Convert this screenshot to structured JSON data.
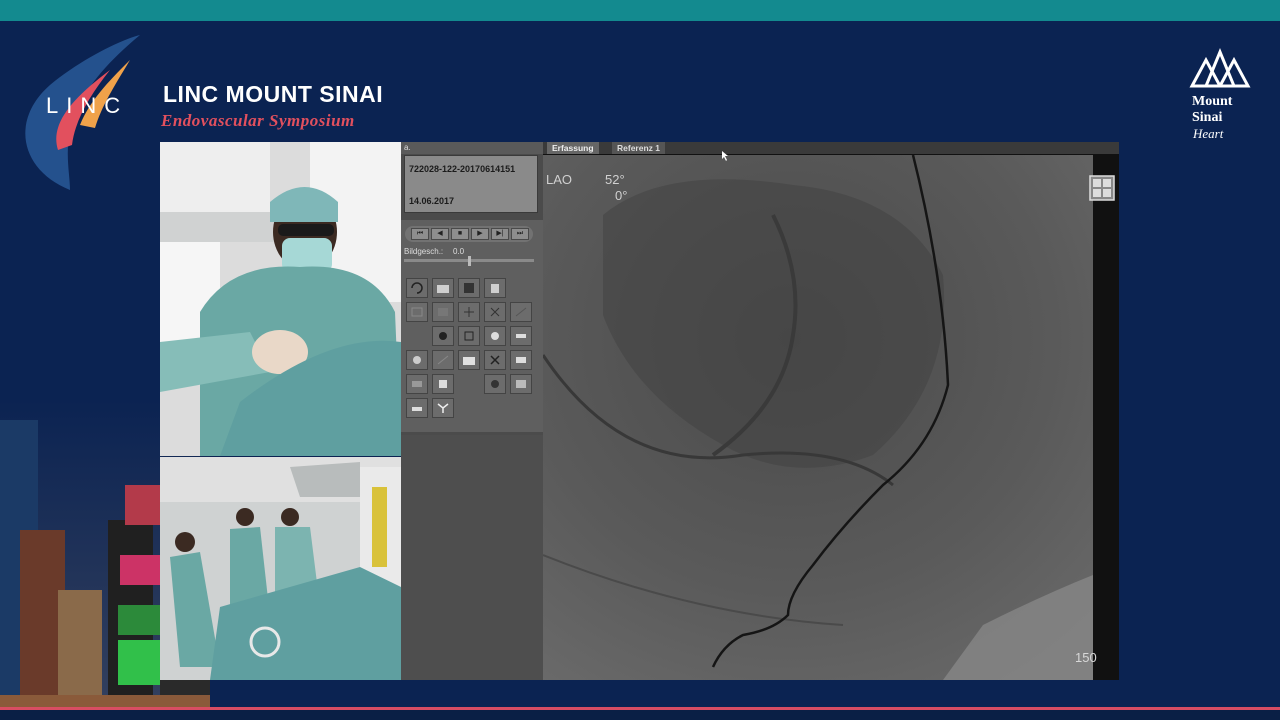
{
  "header": {
    "logo_text": "LINC",
    "title": "LINC MOUNT SINAI",
    "subtitle": "Endovascular Symposium"
  },
  "sponsor": {
    "line1": "Mount",
    "line2": "Sinai",
    "line3": "Heart"
  },
  "panel": {
    "header": "a.",
    "patient_id": "722028-122-20170614151",
    "date": "14.06.2017",
    "transport_buttons": [
      "⏮",
      "◀",
      "■",
      "▶",
      "▶|",
      "⏭"
    ],
    "speed_label": "Bildgesch.:",
    "speed_value": "0.0"
  },
  "viewer": {
    "tabs": [
      "Erfassung",
      "Referenz 1"
    ],
    "projection": "LAO",
    "angle_primary": "52°",
    "angle_secondary": "0°",
    "frame_number": "150"
  },
  "colors": {
    "background": "#0b2352",
    "accent_teal": "#138a8f",
    "accent_red": "#e2505e"
  }
}
